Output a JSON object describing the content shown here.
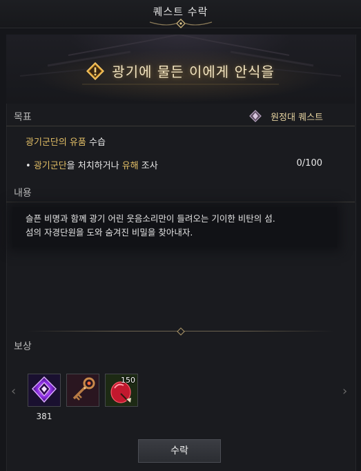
{
  "window": {
    "title": "퀘스트 수락"
  },
  "quest": {
    "name": "광기에 물든 이에게 안식을",
    "type": "원정대 퀘스트"
  },
  "sections": {
    "objective_label": "목표",
    "content_label": "내용",
    "reward_label": "보상"
  },
  "objective": {
    "title_highlight": "광기군단의 유품",
    "title_rest": " 수습",
    "bullet": "•",
    "sub_part1": "광기군단",
    "sub_part2": "을 처치하거나 ",
    "sub_part3": "유해",
    "sub_part4": " 조사",
    "progress": "0/100"
  },
  "description": {
    "line1": "슬픈 비명과 함께 광기 어린 웃음소리만이 들려오는 기이한 비탄의 섬.",
    "line2": "섬의 자경단원을 도와 숨겨진 비밀을 찾아내자."
  },
  "rewards": [
    {
      "icon": "purple-crystal-icon",
      "count": "",
      "below": "381"
    },
    {
      "icon": "ornate-key-icon",
      "count": "",
      "below": ""
    },
    {
      "icon": "red-potion-icon",
      "count": "150",
      "below": ""
    }
  ],
  "buttons": {
    "accept": "수락",
    "prev": "‹",
    "next": "›"
  },
  "colors": {
    "gold": "#e3bf66",
    "title_text": "#f1e3bf",
    "background": "#15161a"
  }
}
